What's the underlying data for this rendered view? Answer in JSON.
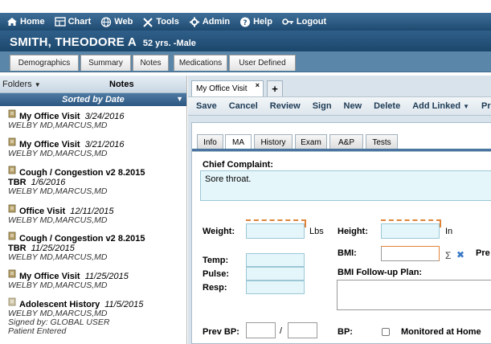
{
  "topbar": {
    "home": "Home",
    "chart": "Chart",
    "web": "Web",
    "tools": "Tools",
    "admin": "Admin",
    "help": "Help",
    "logout": "Logout"
  },
  "patient": {
    "name": "SMITH, THEODORE A",
    "age_sex": "52 yrs. -Male"
  },
  "chart_tabs": [
    "Demographics",
    "Summary",
    "Notes",
    "Medications",
    "User Defined"
  ],
  "sidebar": {
    "folders_label": "Folders",
    "notes_title": "Notes",
    "sort_label": "Sorted by Date",
    "notes": [
      {
        "title": "My Office Visit",
        "date": "3/24/2016",
        "author": "WELBY MD,MARCUS,MD"
      },
      {
        "title": "My Office Visit",
        "date": "3/21/2016",
        "author": "WELBY MD,MARCUS,MD"
      },
      {
        "title": "Cough / Congestion v2 8.2015",
        "title2": "TBR",
        "date": "1/6/2016",
        "author": "WELBY MD,MARCUS,MD"
      },
      {
        "title": "Office Visit",
        "date": "12/11/2015",
        "author": "WELBY MD,MARCUS,MD"
      },
      {
        "title": "Cough / Congestion v2 8.2015",
        "title2": "TBR",
        "date": "11/25/2015",
        "author": "WELBY MD,MARCUS,MD"
      },
      {
        "title": "My Office Visit",
        "date": "11/25/2015",
        "author": "WELBY MD,MARCUS,MD"
      },
      {
        "title": "Adolescent History",
        "date": "11/5/2015",
        "author": "WELBY MD,MARCUS,MD",
        "signed": "Signed by: GLOBAL USER",
        "status": "Patient Entered"
      }
    ]
  },
  "main": {
    "doc_tab": "My Office Visit",
    "doc_tab_close": "×",
    "add_tab": "+",
    "toolbar": [
      "Save",
      "Cancel",
      "Review",
      "Sign",
      "New",
      "Delete",
      "Add Linked",
      "Print"
    ],
    "subtabs": [
      "Info",
      "MA",
      "History",
      "Exam",
      "A&P",
      "Tests"
    ],
    "active_subtab": "MA",
    "form": {
      "chief_complaint_label": "Chief Complaint:",
      "chief_complaint_value": "Sore throat.",
      "weight_label": "Weight:",
      "weight_unit": "Lbs",
      "height_label": "Height:",
      "height_unit": "In",
      "bmi_label": "BMI:",
      "sigma": "Σ",
      "clear": "✖",
      "pre_label": "Pre",
      "temp_label": "Temp:",
      "pulse_label": "Pulse:",
      "resp_label": "Resp:",
      "bmi_plan_label": "BMI Follow-up Plan:",
      "prev_bp_label": "Prev BP:",
      "slash": "/",
      "bp_label": "BP:",
      "monitored_label": "Monitored at Home"
    }
  },
  "colors": {
    "topbar": "#2b5a82",
    "tabstrip": "#5a86a9",
    "field_bg": "#e5f6fb",
    "required_dash": "#e0843a",
    "accent": "#4a75a0"
  }
}
